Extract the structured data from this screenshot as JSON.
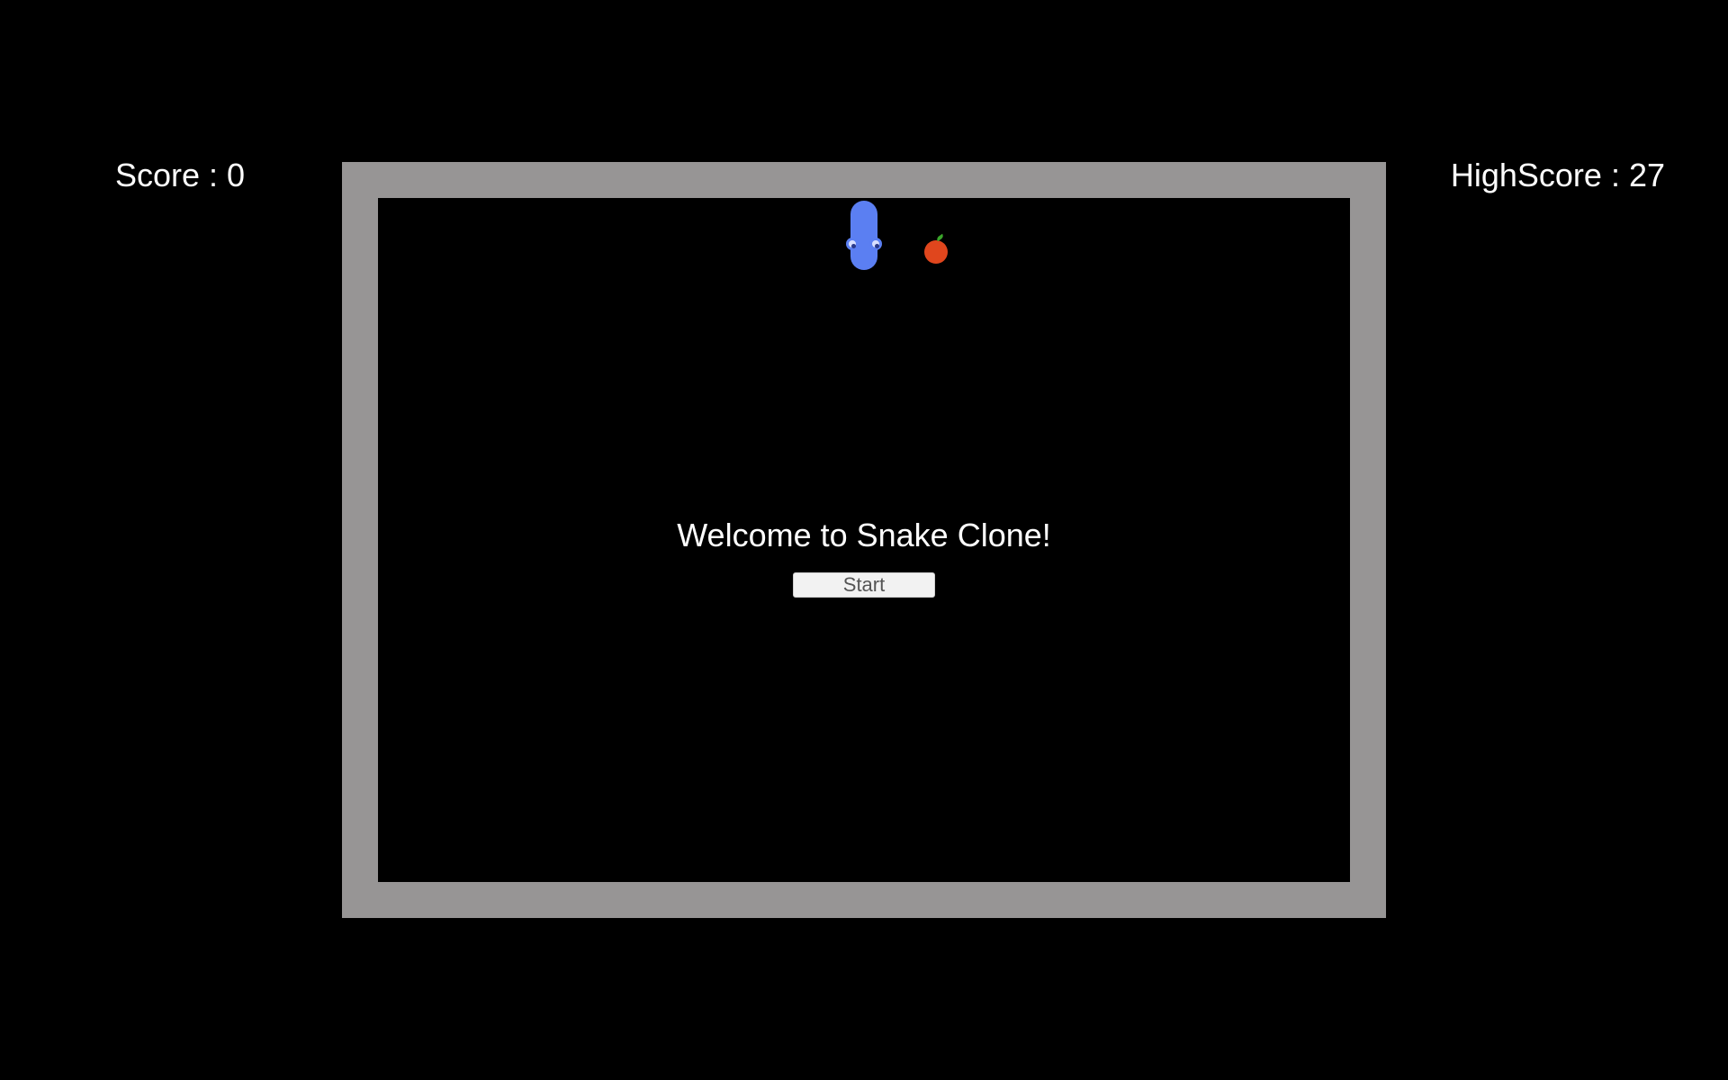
{
  "hud": {
    "score_text": "Score : 0",
    "highscore_text": "HighScore : 27"
  },
  "menu": {
    "welcome_text": "Welcome to Snake Clone!",
    "start_label": "Start"
  },
  "colors": {
    "background": "#000000",
    "border": "#979595",
    "snake": "#5b7ff2",
    "apple": "#e0461d",
    "apple_leaf": "#3aa52a"
  },
  "icons": {
    "snake": "snake-icon",
    "apple": "apple-icon"
  }
}
